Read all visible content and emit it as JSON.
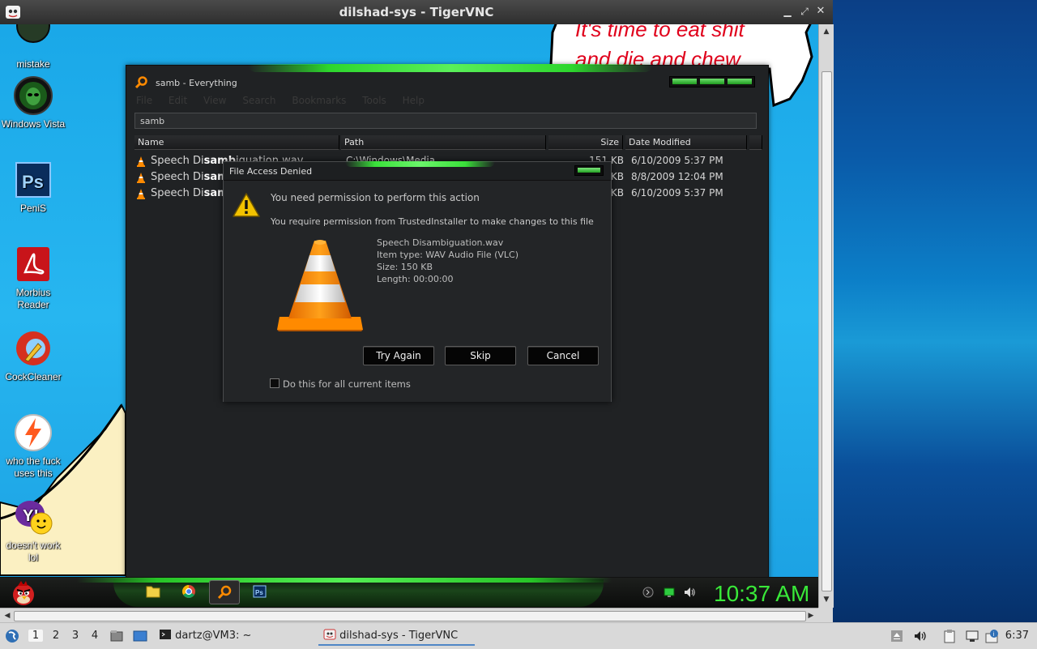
{
  "vnc": {
    "title": "dilshad-sys - TigerVNC"
  },
  "remote_desktop": {
    "banner_text": "It's time to eat shit and die and chew",
    "icons": [
      {
        "name": "mistake",
        "label": "mistake"
      },
      {
        "name": "windows-vista",
        "label": "Windows Vista"
      },
      {
        "name": "penis",
        "label": "PeniS"
      },
      {
        "name": "morbius-reader",
        "label": "Morbius Reader"
      },
      {
        "name": "cockcleaner",
        "label": "CockCleaner"
      },
      {
        "name": "who-the-fuck",
        "label": "who the fuck uses this"
      },
      {
        "name": "doesnt-work",
        "label": "doesn't work lol"
      }
    ]
  },
  "everything": {
    "title": "samb - Everything",
    "menu": [
      "File",
      "Edit",
      "View",
      "Search",
      "Bookmarks",
      "Tools",
      "Help"
    ],
    "search_value": "samb",
    "columns": {
      "name": "Name",
      "path": "Path",
      "size": "Size",
      "date": "Date Modified"
    },
    "rows": [
      {
        "name_pre": "Speech Di",
        "name_bold": "samb",
        "name_post": "iguation.wav",
        "path": "C:\\Windows\\Media",
        "size": "151 KB",
        "date": "6/10/2009 5:37 PM"
      },
      {
        "name_pre": "Speech Di",
        "name_bold": "sam",
        "name_post": "",
        "path": "",
        "size": "KB",
        "date": "8/8/2009 12:04 PM"
      },
      {
        "name_pre": "Speech Di",
        "name_bold": "sam",
        "name_post": "",
        "path": "",
        "size": "KB",
        "date": "6/10/2009 5:37 PM"
      }
    ]
  },
  "dialog": {
    "title": "File Access Denied",
    "message1": "You need permission to perform this action",
    "message2": "You require permission from TrustedInstaller to make changes to this file",
    "file_name": "Speech Disambiguation.wav",
    "item_type": "Item type: WAV Audio File (VLC)",
    "size": "Size: 150 KB",
    "length": "Length: 00:00:00",
    "buttons": {
      "try_again": "Try Again",
      "skip": "Skip",
      "cancel": "Cancel"
    },
    "checkbox_label": "Do this for all current items"
  },
  "remote_taskbar": {
    "clock": "10:37 AM"
  },
  "panel": {
    "workspaces": [
      "1",
      "2",
      "3",
      "4"
    ],
    "tasks": {
      "terminal": "dartz@VM3: ~",
      "vnc": "dilshad-sys - TigerVNC"
    },
    "clock": "6:37"
  }
}
